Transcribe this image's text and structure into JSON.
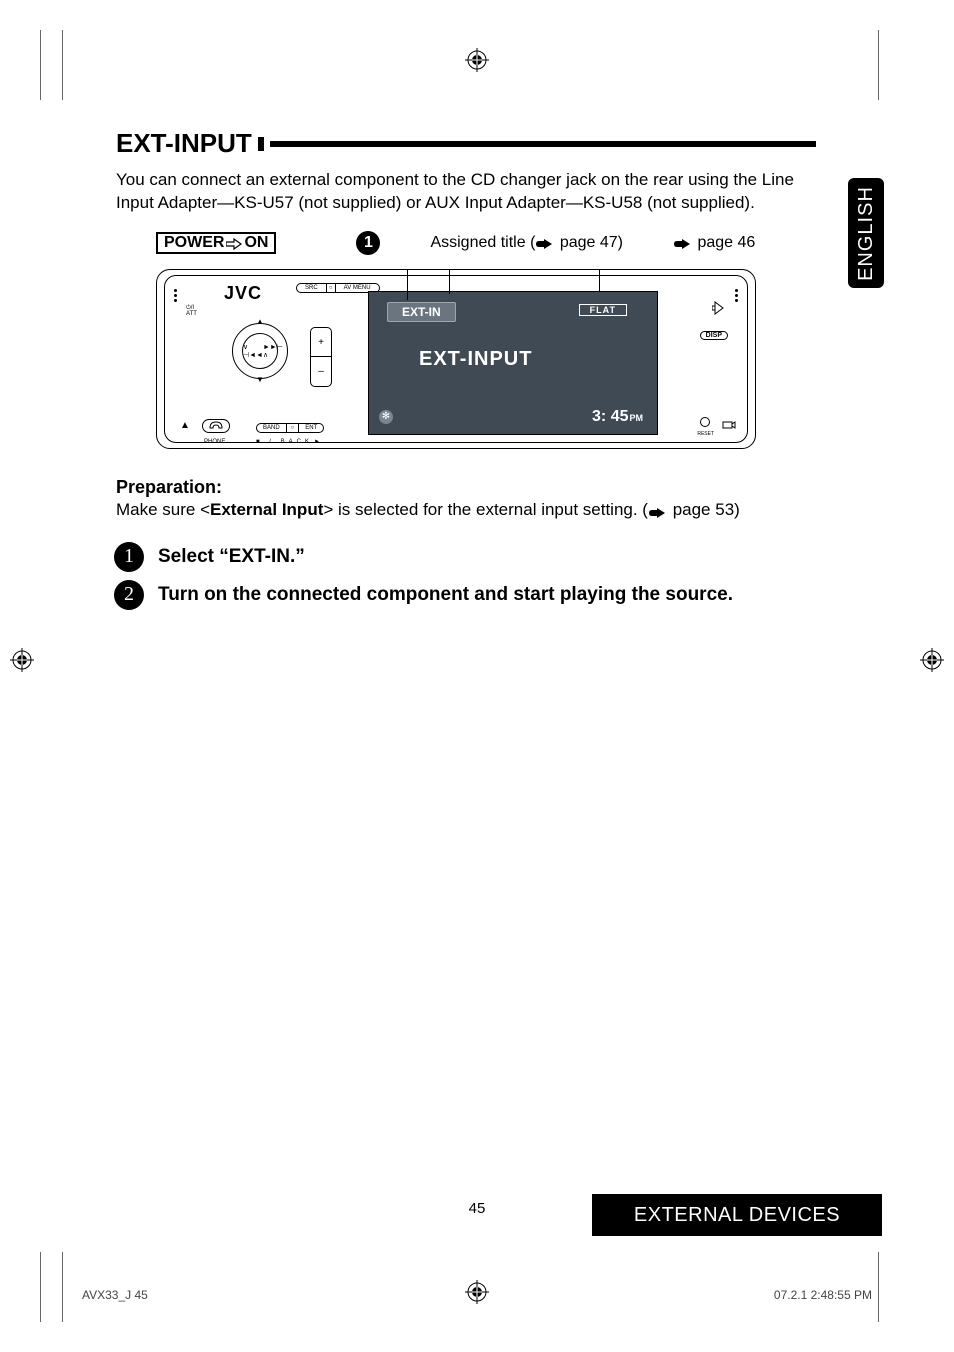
{
  "lang_tab": "ENGLISH",
  "heading": "EXT-INPUT",
  "intro": "You can connect an external component to the CD changer jack on the rear using the Line Input Adapter—KS-U57 (not supplied) or AUX Input Adapter—KS-U58 (not supplied).",
  "callout": {
    "power_label_l": "POWER",
    "power_label_r": "ON",
    "step1_num": "1",
    "assigned": "Assigned title (",
    "assigned_page": " page 47)",
    "pageref": " page 46"
  },
  "device": {
    "brand": "JVC",
    "src": "SRC",
    "avmenu": "AV MENU",
    "att": "/I\nATT",
    "plus": "+",
    "minus": "–",
    "prev": "⋁⊣◄◄",
    "next": "►►⊢⋀",
    "eject": "▲",
    "phone_label": "PHONE",
    "band": "BAND",
    "ent": "ENT",
    "back": "■ / BACK",
    "play": "►",
    "disp": "DISP",
    "reset": "RESET",
    "screen": {
      "tab": "EXT-IN",
      "flat": "FLAT",
      "big": "EXT-INPUT",
      "bt": "✻",
      "clock": "3: 45",
      "pm": "PM"
    }
  },
  "prep": {
    "title": "Preparation:",
    "body_pre": "Make sure <",
    "body_bold": "External Input",
    "body_post": "> is selected for the external input setting. (",
    "body_page": " page 53)"
  },
  "steps": {
    "s1_num": "1",
    "s1": "Select “EXT-IN.”",
    "s2_num": "2",
    "s2": "Turn on the connected component and start playing the source."
  },
  "footer": {
    "page": "45",
    "bar": "EXTERNAL DEVICES",
    "meta_left": "AVX33_J   45",
    "meta_right": "07.2.1   2:48:55 PM"
  }
}
